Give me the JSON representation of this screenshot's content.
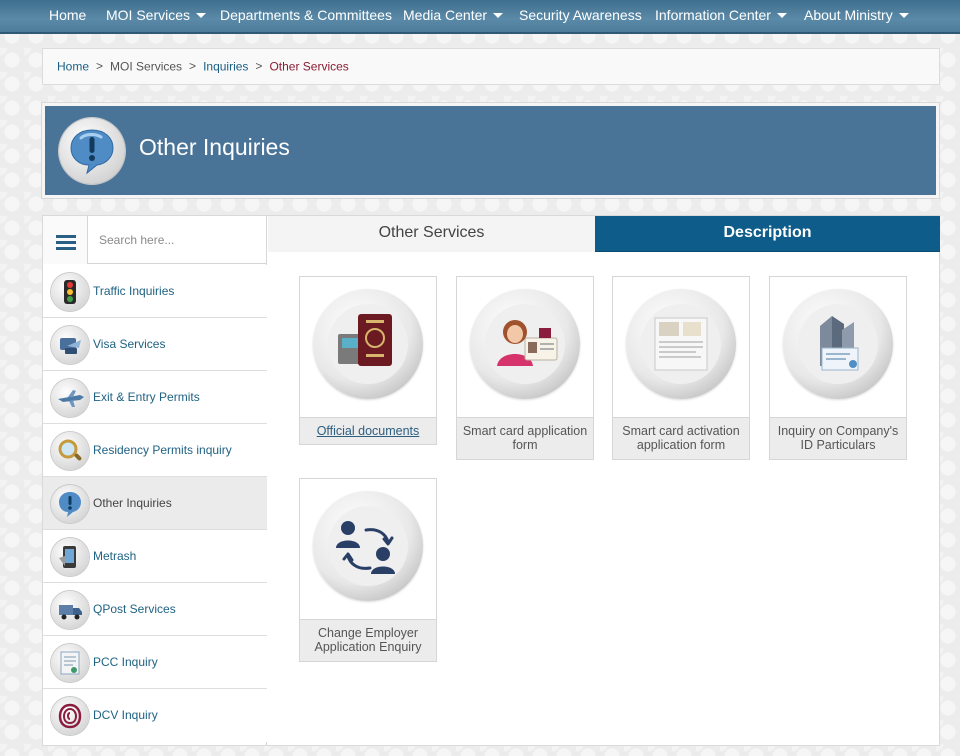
{
  "nav": {
    "items": [
      {
        "label": "Home",
        "dropdown": false
      },
      {
        "label": "MOI Services",
        "dropdown": true
      },
      {
        "label": "Departments & Committees",
        "dropdown": false
      },
      {
        "label": "Media Center",
        "dropdown": true
      },
      {
        "label": "Security Awareness",
        "dropdown": false
      },
      {
        "label": "Information Center",
        "dropdown": true
      },
      {
        "label": "About Ministry",
        "dropdown": true
      }
    ]
  },
  "breadcrumb": {
    "home": "Home",
    "sep": ">",
    "moi_services": "MOI Services",
    "inquiries": "Inquiries",
    "current": "Other Services"
  },
  "banner": {
    "title": "Other Inquiries",
    "icon": "exclamation-bubble-icon"
  },
  "search": {
    "placeholder": "Search here..."
  },
  "sidebar": {
    "items": [
      {
        "label": "Traffic Inquiries",
        "icon": "traffic-light-icon",
        "active": false
      },
      {
        "label": "Visa Services",
        "icon": "visa-passport-icon",
        "active": false
      },
      {
        "label": "Exit & Entry Permits",
        "icon": "airplane-icon",
        "active": false
      },
      {
        "label": "Residency Permits inquiry",
        "icon": "residency-magnifier-icon",
        "active": false
      },
      {
        "label": "Other Inquiries",
        "icon": "exclamation-bubble-icon",
        "active": true
      },
      {
        "label": "Metrash",
        "icon": "metrash-phone-icon",
        "active": false
      },
      {
        "label": "QPost Services",
        "icon": "delivery-truck-icon",
        "active": false
      },
      {
        "label": "PCC Inquiry",
        "icon": "pcc-certificate-icon",
        "active": false
      },
      {
        "label": "DCV Inquiry",
        "icon": "dcv-fingerprint-icon",
        "active": false
      }
    ]
  },
  "tabs": {
    "other_services": "Other Services",
    "description": "Description"
  },
  "tiles": [
    {
      "label": "Official documents",
      "icon": "official-documents-icon"
    },
    {
      "label": "Smart card application form",
      "icon": "smart-card-application-icon"
    },
    {
      "label": "Smart card activation application form",
      "icon": "smart-card-activation-icon"
    },
    {
      "label": "Inquiry on Company's ID Particulars",
      "icon": "company-id-icon"
    },
    {
      "label": "Change Employer Application Enquiry",
      "icon": "change-employer-icon"
    }
  ],
  "colors": {
    "nav_bg": "#4d7c9a",
    "banner_bg": "#4a7398",
    "tab_active_bg": "#0e5c8a",
    "link": "#1f6283",
    "breadcrumb_current": "#8a1c33"
  }
}
